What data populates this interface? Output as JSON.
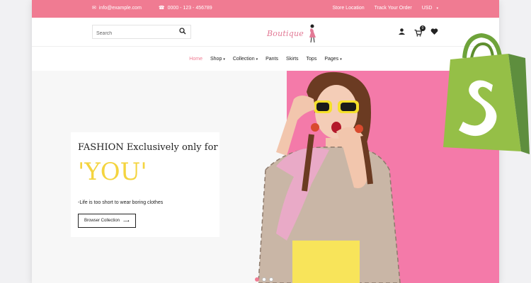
{
  "topbar": {
    "email": "info@example.com",
    "phone": "0000 - 123 - 456789",
    "store_location": "Store Location",
    "track_order": "Track Your Order",
    "currency": "USD"
  },
  "header": {
    "search_placeholder": "Search",
    "logo_text": "Boutique",
    "cart_count": "0"
  },
  "nav": {
    "items": [
      {
        "label": "Home",
        "active": true
      },
      {
        "label": "Shop",
        "dropdown": true
      },
      {
        "label": "Collection",
        "dropdown": true
      },
      {
        "label": "Pants"
      },
      {
        "label": "Skirts"
      },
      {
        "label": "Tops"
      },
      {
        "label": "Pages",
        "dropdown": true
      }
    ]
  },
  "hero": {
    "title_prefix": "FASHION Exclusively only for",
    "title_big": "'YOU'",
    "subtitle": "-Life is too short to wear boring clothes",
    "button_label": "Browser Collection",
    "button_icon": "arrow-right-icon",
    "slide_count": 3,
    "active_slide": 1
  },
  "colors": {
    "accent": "#f07b92",
    "hero_pink": "#f47aa9",
    "yellow": "#f4d43f",
    "shopify_green": "#95bf47"
  },
  "icons": [
    "mail-icon",
    "phone-icon",
    "search-icon",
    "user-icon",
    "cart-icon",
    "heart-icon",
    "shopify-bag-icon"
  ]
}
